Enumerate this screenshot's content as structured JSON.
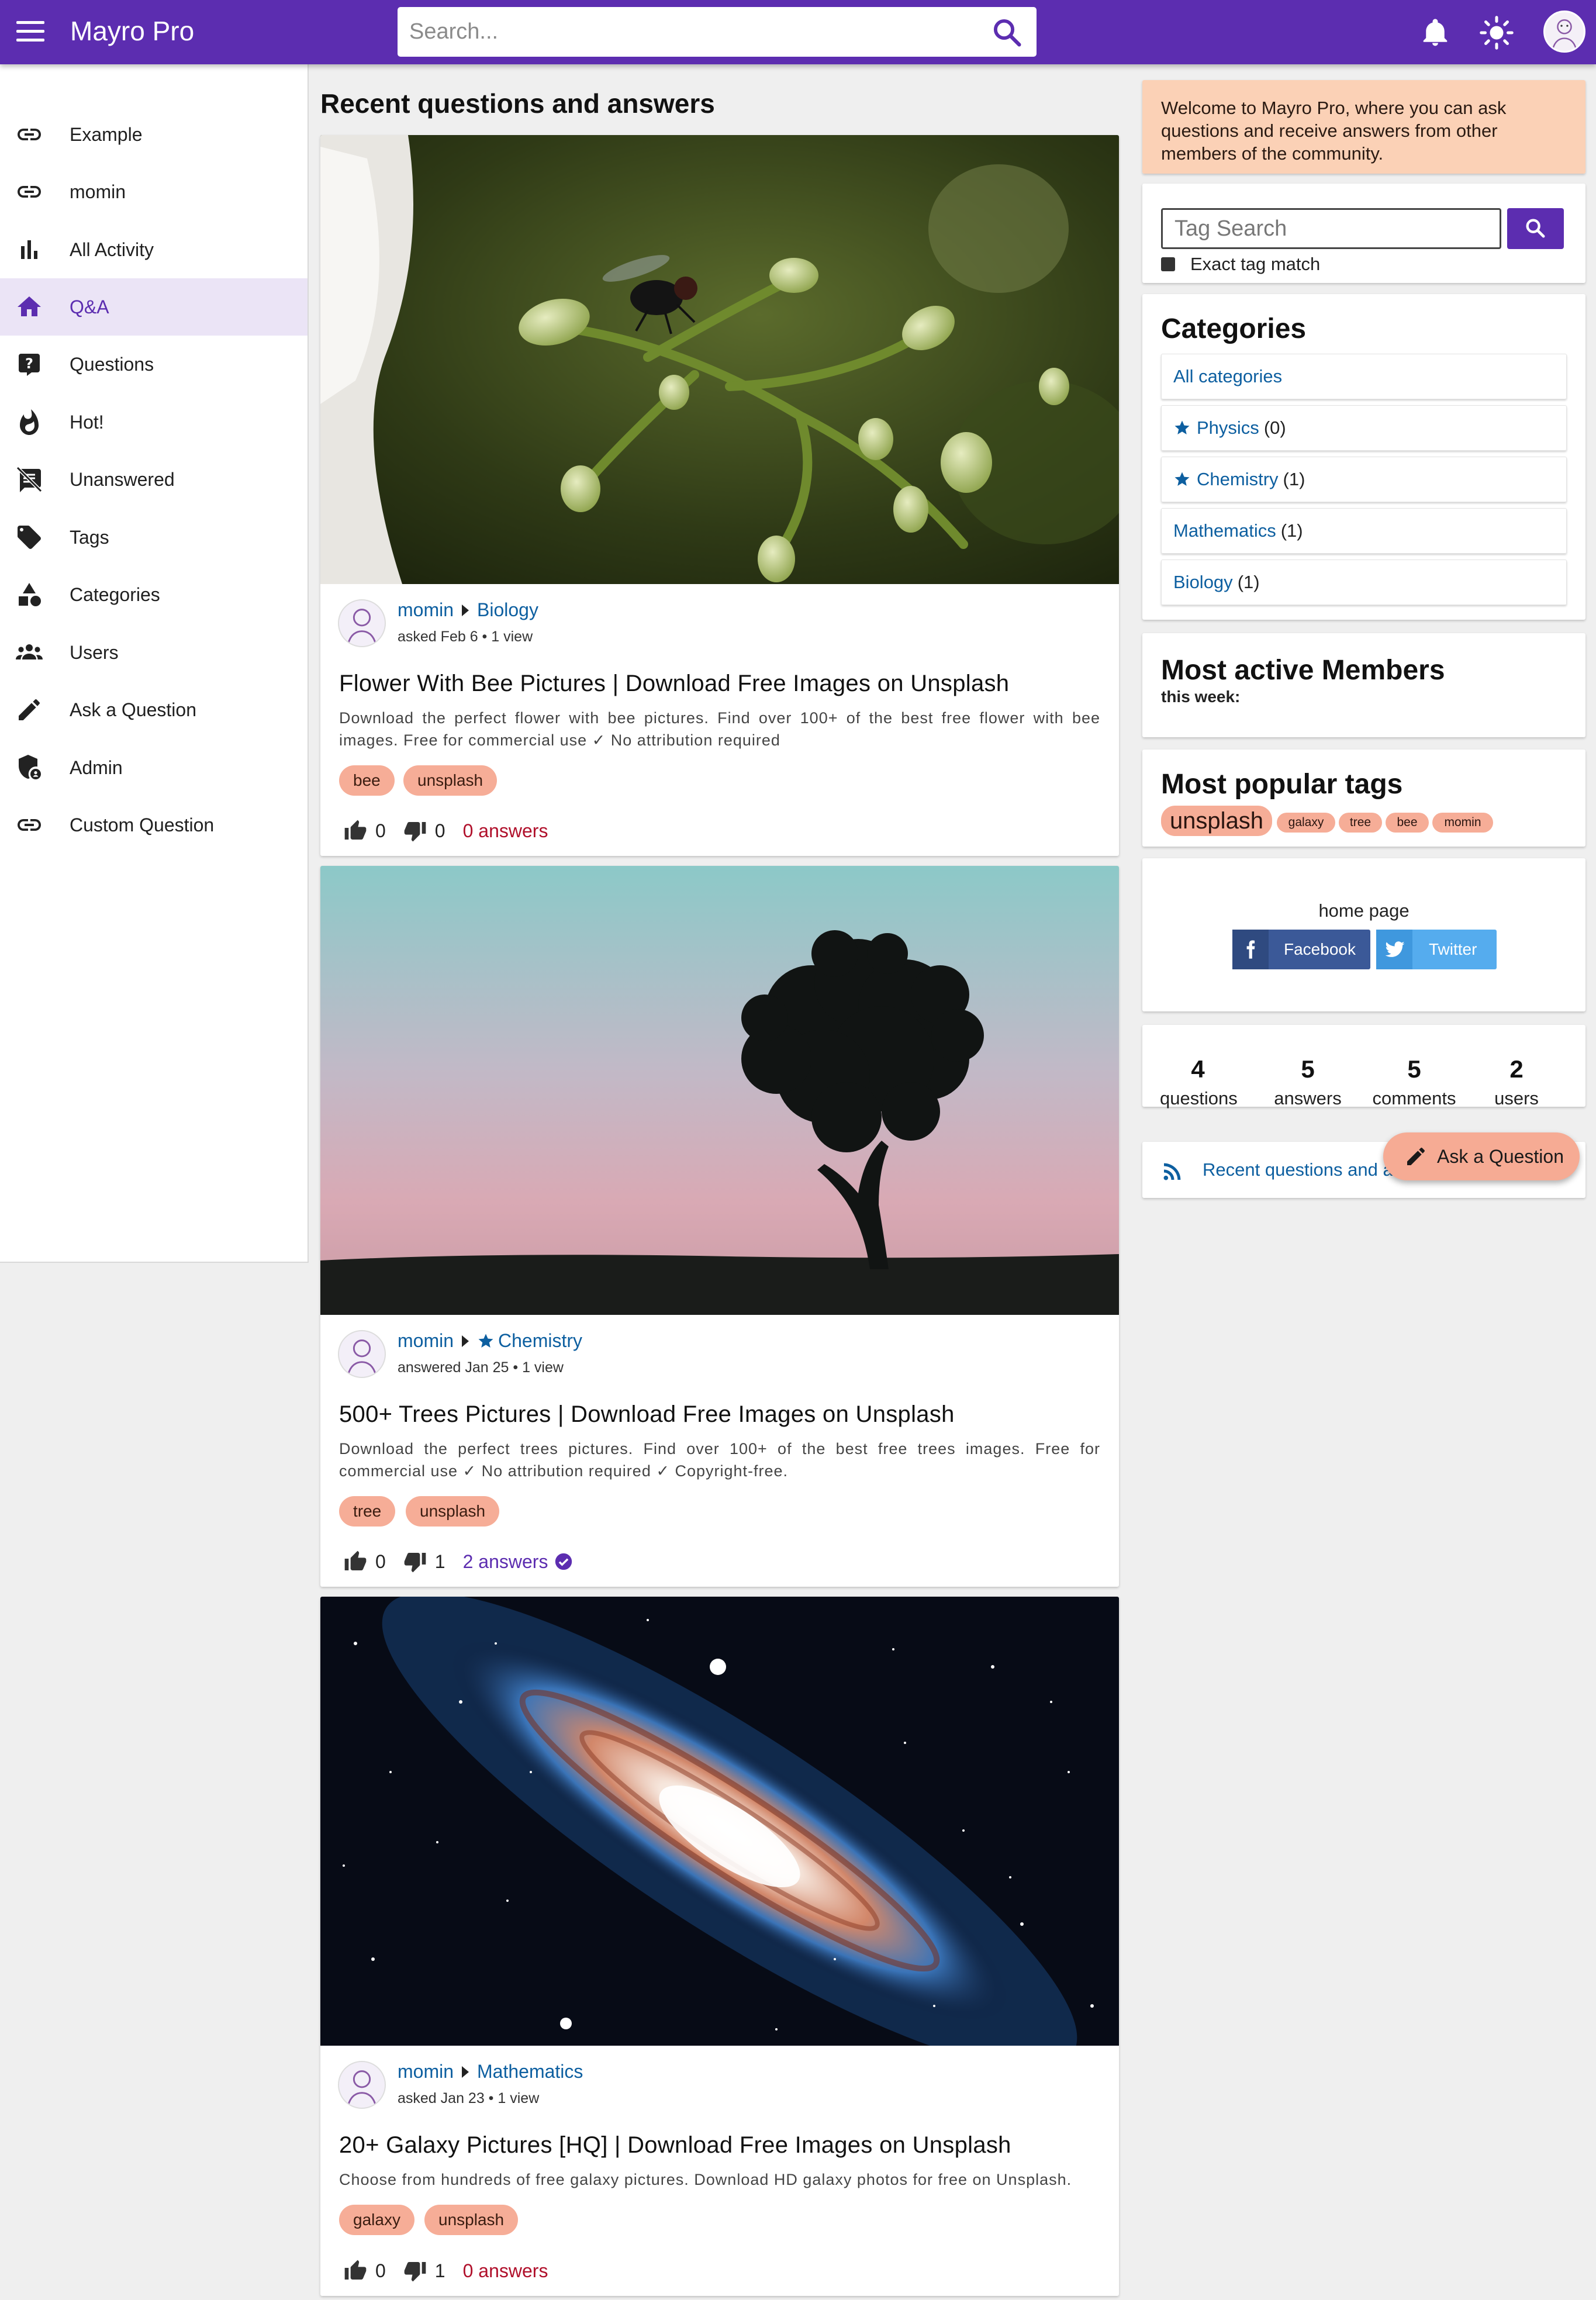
{
  "app": {
    "title": "Mayro Pro",
    "search_placeholder": "Search..."
  },
  "sidebar": {
    "items": [
      {
        "label": "Example",
        "icon": "link-icon"
      },
      {
        "label": "momin",
        "icon": "link-icon"
      },
      {
        "label": "All Activity",
        "icon": "bar-chart-icon"
      },
      {
        "label": "Q&A",
        "icon": "home-icon",
        "active": true
      },
      {
        "label": "Questions",
        "icon": "question-icon"
      },
      {
        "label": "Hot!",
        "icon": "flame-icon"
      },
      {
        "label": "Unanswered",
        "icon": "comment-off-icon"
      },
      {
        "label": "Tags",
        "icon": "tag-icon"
      },
      {
        "label": "Categories",
        "icon": "shapes-icon"
      },
      {
        "label": "Users",
        "icon": "users-icon"
      },
      {
        "label": "Ask a Question",
        "icon": "pencil-icon"
      },
      {
        "label": "Admin",
        "icon": "admin-shield-icon"
      },
      {
        "label": "Custom Question",
        "icon": "link-icon"
      }
    ]
  },
  "main": {
    "heading": "Recent questions and answers",
    "questions": [
      {
        "author": "momin",
        "category": "Biology",
        "category_starred": false,
        "action": "asked",
        "date": "Feb 6",
        "views": "1 view",
        "title": "Flower With Bee Pictures | Download Free Images on Unsplash",
        "description": "Download the perfect flower with bee pictures. Find over 100+ of the best free flower with bee images. Free for commercial use ✓ No attribution required",
        "tags": [
          "bee",
          "unsplash"
        ],
        "upvotes": "0",
        "downvotes": "0",
        "answers": "0 answers",
        "has_answer": false
      },
      {
        "author": "momin",
        "category": "Chemistry",
        "category_starred": true,
        "action": "answered",
        "date": "Jan 25",
        "views": "1 view",
        "title": "500+ Trees Pictures | Download Free Images on Unsplash",
        "description": "Download the perfect trees pictures. Find over 100+ of the best free trees images. Free for commercial use ✓ No attribution required ✓ Copyright-free.",
        "tags": [
          "tree",
          "unsplash"
        ],
        "upvotes": "0",
        "downvotes": "1",
        "answers": "2 answers",
        "has_answer": true
      },
      {
        "author": "momin",
        "category": "Mathematics",
        "category_starred": false,
        "action": "asked",
        "date": "Jan 23",
        "views": "1 view",
        "title": "20+ Galaxy Pictures [HQ] | Download Free Images on Unsplash",
        "description": "Choose from hundreds of free galaxy pictures. Download HD galaxy photos for free on Unsplash.",
        "tags": [
          "galaxy",
          "unsplash"
        ],
        "upvotes": "0",
        "downvotes": "1",
        "answers": "0 answers",
        "has_answer": false
      }
    ]
  },
  "right": {
    "welcome": "Welcome to Mayro Pro, where you can ask questions and receive answers from other members of the community.",
    "tag_search_placeholder": "Tag Search",
    "exact_match_label": "Exact tag match",
    "categories_heading": "Categories",
    "categories": [
      {
        "name": "All categories",
        "count": "",
        "starred": false
      },
      {
        "name": "Physics",
        "count": "(0)",
        "starred": true
      },
      {
        "name": "Chemistry",
        "count": "(1)",
        "starred": true
      },
      {
        "name": "Mathematics",
        "count": "(1)",
        "starred": false
      },
      {
        "name": "Biology",
        "count": "(1)",
        "starred": false
      }
    ],
    "active_members_heading": "Most active Members",
    "active_members_sub": "this week:",
    "popular_tags_heading": "Most popular tags",
    "popular_tags": [
      "unsplash",
      "galaxy",
      "tree",
      "bee",
      "momin"
    ],
    "share_label": "home page",
    "facebook": "Facebook",
    "twitter": "Twitter",
    "stats": [
      {
        "n": "4",
        "l": "questions"
      },
      {
        "n": "5",
        "l": "answers"
      },
      {
        "n": "5",
        "l": "comments"
      },
      {
        "n": "2",
        "l": "users"
      }
    ],
    "rss_label": "Recent questions and answers"
  },
  "fab": {
    "label": "Ask a Question"
  },
  "colors": {
    "primary": "#5c2db0",
    "tag": "#f6ad97",
    "link": "#0d5fa0",
    "no_answers": "#b0102b"
  }
}
